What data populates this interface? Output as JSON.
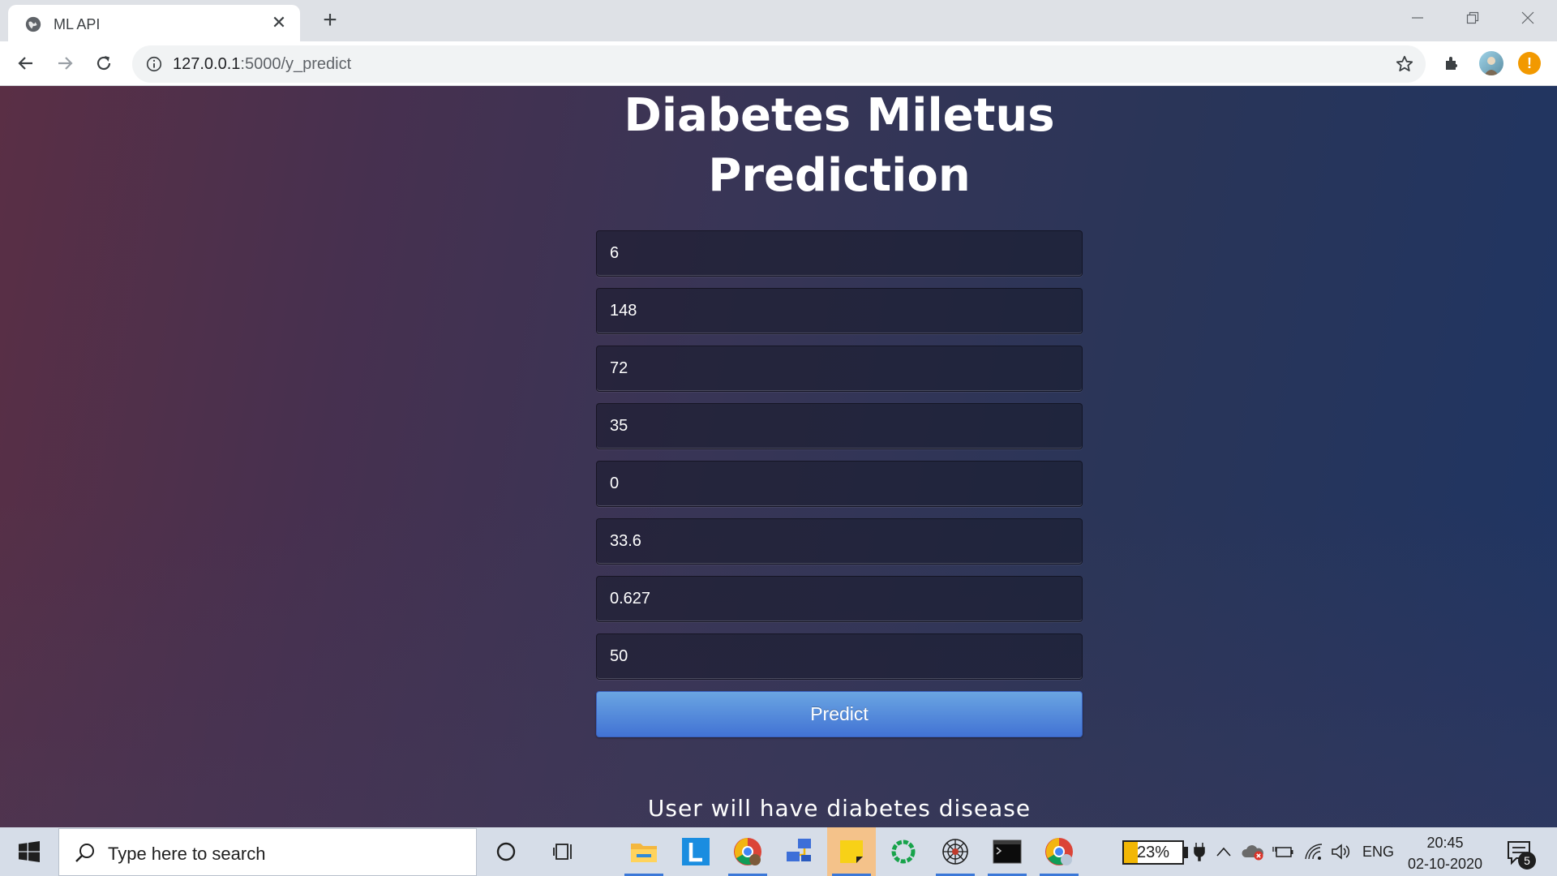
{
  "browser": {
    "tab_title": "ML API",
    "url_host": "127.0.0.1",
    "url_path": ":5000/y_predict",
    "new_tab_symbol": "+",
    "close_symbol": "✕"
  },
  "page": {
    "title_line1": "Diabetes Miletus",
    "title_line2": "Prediction",
    "fields": [
      "6",
      "148",
      "72",
      "35",
      "0",
      "33.6",
      "0.627",
      "50"
    ],
    "predict_label": "Predict",
    "result_text": "User will have diabetes disease"
  },
  "taskbar": {
    "search_placeholder": "Type here to search",
    "battery_percent": "23%",
    "battery_level": 0.23,
    "language": "ENG",
    "time": "20:45",
    "date": "02-10-2020",
    "notification_count": "5",
    "pinned_apps": [
      "cortana-icon",
      "task-view-icon",
      "file-explorer-icon",
      "l-app-icon",
      "chrome-profile-icon",
      "network-app-icon",
      "sticky-notes-icon",
      "ring-app-icon",
      "spider-app-icon",
      "terminal-icon",
      "chrome-icon"
    ]
  },
  "colors": {
    "accent": "#4a7fd8",
    "page_start": "#5a2f45",
    "page_end": "#1f3563"
  }
}
